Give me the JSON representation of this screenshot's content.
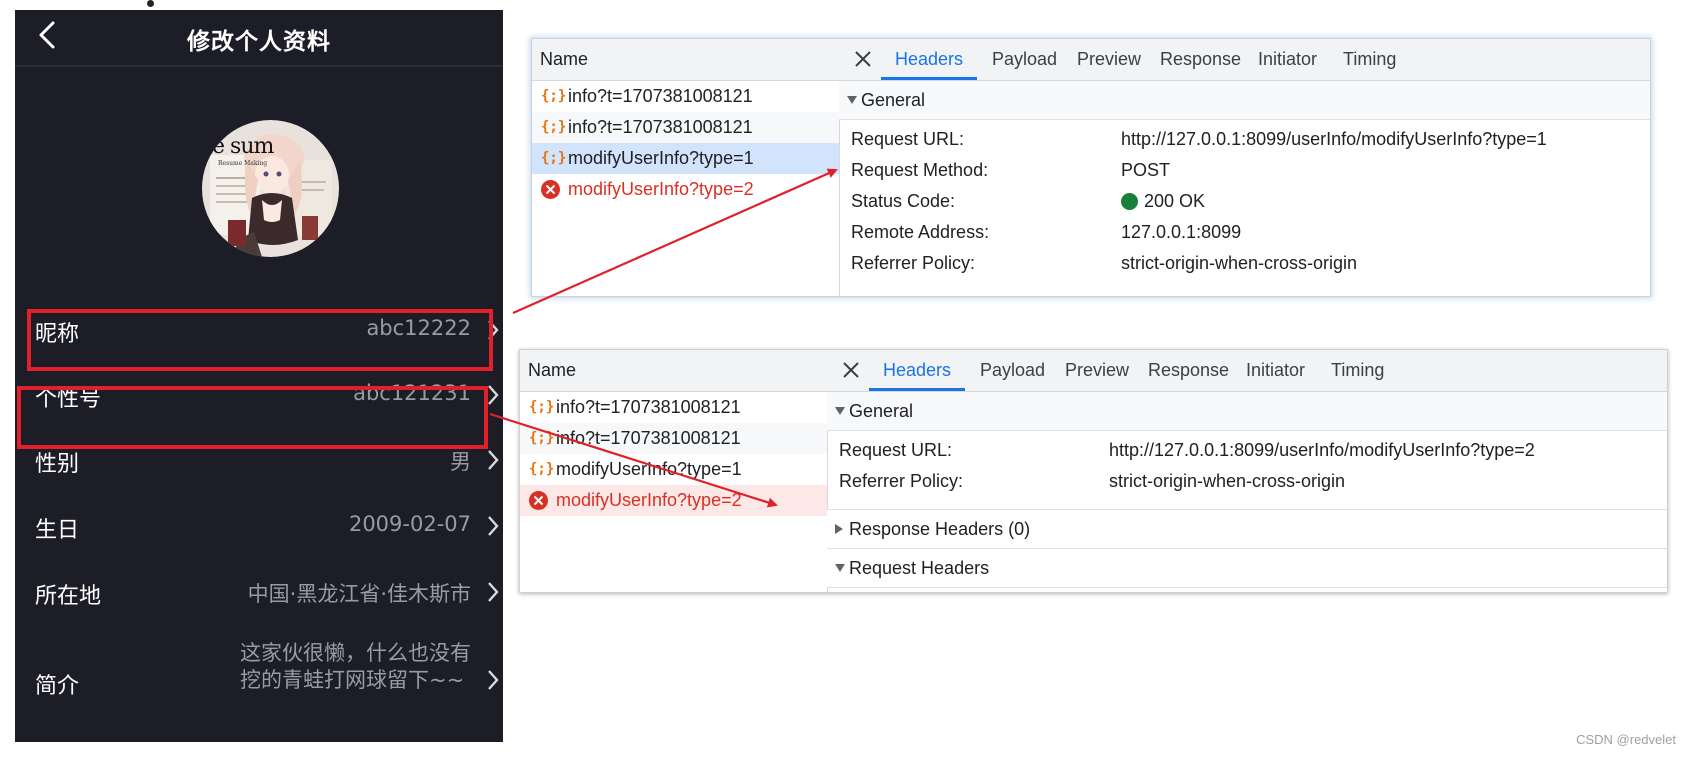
{
  "mobile": {
    "title": "修改个人资料",
    "rows": [
      {
        "label": "昵称",
        "value": "abc12222"
      },
      {
        "label": "个性号",
        "value": "abc121231"
      },
      {
        "label": "性别",
        "value": "男"
      },
      {
        "label": "生日",
        "value": "2009-02-07"
      },
      {
        "label": "所在地",
        "value": "中国·黑龙江省·佳木斯市"
      },
      {
        "label": "简介",
        "value_line1": "这家伙很懒，什么也没有",
        "value_line2": "挖的青蛙打网球留下~~"
      }
    ],
    "avatar_text": "le sum",
    "avatar_caption": "Resume Making"
  },
  "devtools1": {
    "name_header": "Name",
    "requests": [
      {
        "name": "info?t=1707381008121",
        "type": "xhr"
      },
      {
        "name": "info?t=1707381008121",
        "type": "xhr"
      },
      {
        "name": "modifyUserInfo?type=1",
        "type": "xhr",
        "selected": true
      },
      {
        "name": "modifyUserInfo?type=2",
        "type": "error"
      }
    ],
    "tabs": [
      "Headers",
      "Payload",
      "Preview",
      "Response",
      "Initiator",
      "Timing"
    ],
    "active_tab": "Headers",
    "section": "General",
    "fields": [
      {
        "key": "Request URL:",
        "value": "http://127.0.0.1:8099/userInfo/modifyUserInfo?type=1"
      },
      {
        "key": "Request Method:",
        "value": "POST"
      },
      {
        "key": "Status Code:",
        "value": "200 OK"
      },
      {
        "key": "Remote Address:",
        "value": "127.0.0.1:8099"
      },
      {
        "key": "Referrer Policy:",
        "value": "strict-origin-when-cross-origin"
      }
    ]
  },
  "devtools2": {
    "name_header": "Name",
    "requests": [
      {
        "name": "info?t=1707381008121",
        "type": "xhr"
      },
      {
        "name": "info?t=1707381008121",
        "type": "xhr"
      },
      {
        "name": "modifyUserInfo?type=1",
        "type": "xhr"
      },
      {
        "name": "modifyUserInfo?type=2",
        "type": "error",
        "selected": true
      }
    ],
    "tabs": [
      "Headers",
      "Payload",
      "Preview",
      "Response",
      "Initiator",
      "Timing"
    ],
    "section": "General",
    "fields": [
      {
        "key": "Request URL:",
        "value": "http://127.0.0.1:8099/userInfo/modifyUserInfo?type=2"
      },
      {
        "key": "Referrer Policy:",
        "value": "strict-origin-when-cross-origin"
      }
    ],
    "response_headers": "Response Headers (0)",
    "request_headers": "Request Headers"
  },
  "colors": {
    "accent": "#1a73e8",
    "error": "#d93025",
    "highlight": "#e0202a",
    "status_ok": "#188038",
    "phone_bg": "#1c1d27"
  },
  "watermark": "CSDN @redvelet"
}
